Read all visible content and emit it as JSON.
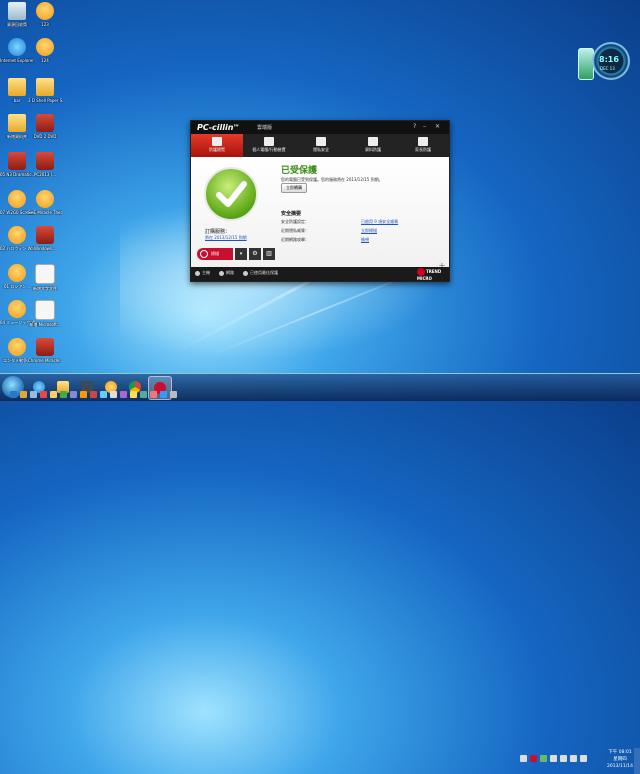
{
  "desktop": {
    "icons_left": [
      {
        "label": "資源回收筒",
        "type": "bin"
      },
      {
        "label": "Internet Explorer",
        "type": "ie"
      },
      {
        "label": "bar",
        "type": "folder"
      },
      {
        "label": "新增資料夾",
        "type": "folder"
      },
      {
        "label": "05 N3 Dramatic...",
        "type": "app"
      },
      {
        "label": "07 W2G0 Screen...",
        "type": "face"
      },
      {
        "label": "02 ハロウィン Wars...",
        "type": "face"
      },
      {
        "label": "01 ロシアン...",
        "type": "face"
      },
      {
        "label": "04 ミュージック Wars...",
        "type": "face"
      },
      {
        "label": "エンタメ戦争...",
        "type": "face"
      }
    ],
    "icons_right": [
      {
        "label": "123",
        "type": "face"
      },
      {
        "label": "124",
        "type": "face"
      },
      {
        "label": "3 D Shell Paper Sun...",
        "type": "folder"
      },
      {
        "label": "DVD 2 DVD",
        "type": "app"
      },
      {
        "label": "PC2013 (...",
        "type": "app"
      },
      {
        "label": "SHE Miracle Theater",
        "type": "face"
      },
      {
        "label": "Windows...",
        "type": "app"
      },
      {
        "label": "新增文字文件",
        "type": "doc"
      },
      {
        "label": "新增 Microsoft...",
        "type": "doc"
      },
      {
        "label": "Chrome Miracle...",
        "type": "app"
      }
    ]
  },
  "gadget": {
    "time": "8:16",
    "date": "DEC 13"
  },
  "app": {
    "logo": "PC-cillin",
    "logo_tm": "TM",
    "edition": "雲端版",
    "title_controls": [
      "?",
      "–",
      "✕"
    ],
    "tabs": [
      {
        "label": "防護總覽",
        "active": true
      },
      {
        "label": "個人電腦/行動裝置",
        "active": false
      },
      {
        "label": "隱私安全",
        "active": false
      },
      {
        "label": "資料防護",
        "active": false
      },
      {
        "label": "家長防護",
        "active": false
      }
    ],
    "subscription_label": "訂購服務：",
    "subscription_link": "將在 2013/12/15 到期",
    "scan_label": "掃描",
    "status_title": "已受保護",
    "status_desc": "您的電腦已受到保護。您的服務將在 2013/12/15 到期。",
    "renew_button": "立即續購",
    "summary_title": "安全摘要",
    "summary_rows": [
      {
        "label": "安全防護設定：",
        "value": "已啟用 9 項安全威脅"
      },
      {
        "label": "近期隱私威脅：",
        "value": "立即掃描"
      },
      {
        "label": "近期網路攻擊：",
        "value": "檢視"
      }
    ],
    "footer": [
      {
        "label": "主機"
      },
      {
        "label": "網路"
      },
      {
        "label": "已使用最佳保護"
      }
    ],
    "brand": "TREND MICRO",
    "accent_color": "#c8102e",
    "status_color": "#3a8b14"
  },
  "taskbar": {
    "clock_time": "下午 08:01",
    "clock_day": "星期四",
    "clock_date": "2013/11/14"
  }
}
